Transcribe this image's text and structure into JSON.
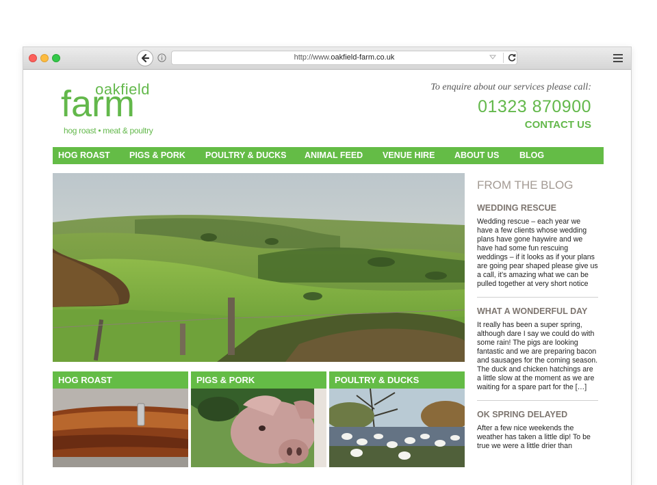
{
  "browser": {
    "url_prefix": "http://www.",
    "url_domain": "oakfield-farm.co.uk"
  },
  "header": {
    "logo_top": "oakfield",
    "logo_main": "farm",
    "logo_sub": "hog roast • meat & poultry",
    "enquire": "To enquire about our services please call:",
    "phone": "01323 870900",
    "contact": "CONTACT US"
  },
  "nav": {
    "items": [
      "HOG ROAST",
      "PIGS & PORK",
      "POULTRY & DUCKS",
      "ANIMAL FEED",
      "VENUE HIRE",
      "ABOUT US",
      "BLOG"
    ]
  },
  "tiles": [
    "HOG ROAST",
    "PIGS & PORK",
    "POULTRY & DUCKS"
  ],
  "sidebar": {
    "title": "FROM THE BLOG",
    "posts": [
      {
        "title": "WEDDING RESCUE",
        "body": "Wedding rescue – each year we have a few clients whose wedding plans have gone haywire and we have had some fun rescuing weddings – if it looks as if your plans are going pear shaped please give us a call, it’s amazing what we can be pulled together at very short notice"
      },
      {
        "title": "WHAT A WONDERFUL DAY",
        "body": "It really has been a super spring, although dare I say we could do with some rain! The pigs are looking fantastic and we are preparing bacon and sausages for the coming season. The duck and chicken hatchings are a little slow at the moment as we are waiting for a spare part for the […]"
      },
      {
        "title": "OK SPRING DELAYED",
        "body": "After a few nice weekends the weather has taken a little dip! To be true we were a little drier than"
      }
    ]
  },
  "colors": {
    "brand_green": "#64bc46",
    "sidebar_heading": "#a39a93"
  }
}
